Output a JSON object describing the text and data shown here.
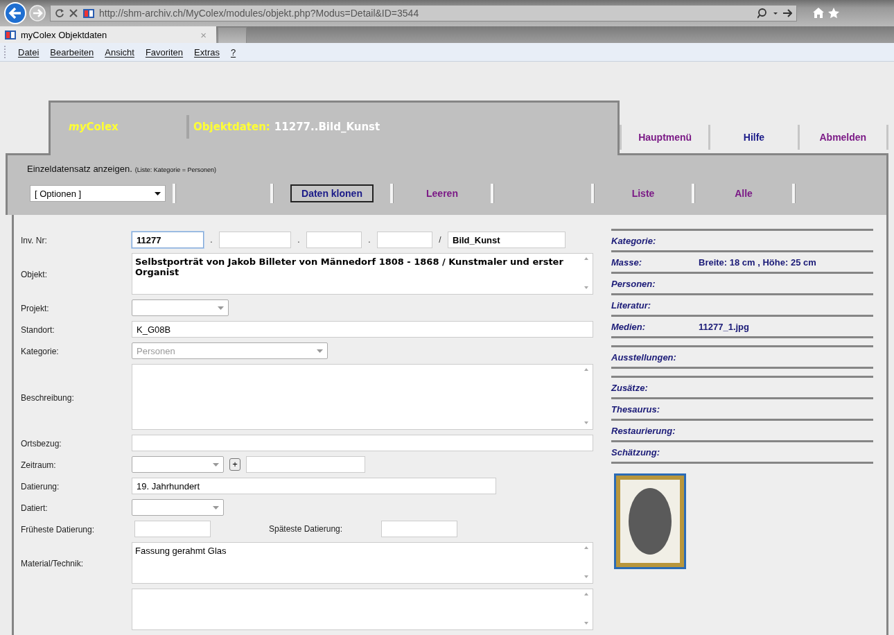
{
  "browser": {
    "url": "http://shm-archiv.ch/MyColex/modules/objekt.php?Modus=Detail&ID=3544",
    "tab_title": "myColex Objektdaten",
    "tab_close": "×",
    "menu": [
      {
        "label": "Datei"
      },
      {
        "label": "Bearbeiten"
      },
      {
        "label": "Ansicht"
      },
      {
        "label": "Favoriten"
      },
      {
        "label": "Extras"
      },
      {
        "label": "?"
      }
    ]
  },
  "app": {
    "brand_prefix": "my",
    "brand_name": "Colex",
    "title_label": "Objektdaten:",
    "title_value": "11277..Bild_Kunst",
    "nav": [
      {
        "label": "Hauptmenü",
        "visited": true
      },
      {
        "label": "Hilfe",
        "visited": false
      },
      {
        "label": "Abmelden",
        "visited": true
      }
    ],
    "mode_text": "Einzeldatensatz anzeigen.",
    "filter_note": "(Liste: Kategorie = Personen)",
    "options_select": "[ Optionen ]",
    "actions": [
      {
        "kind": "gap"
      },
      {
        "kind": "button",
        "label": "Daten klonen"
      },
      {
        "kind": "link",
        "label": "Leeren"
      },
      {
        "kind": "gap"
      },
      {
        "kind": "link",
        "label": "Liste"
      },
      {
        "kind": "link",
        "label": "Alle"
      }
    ]
  },
  "form": {
    "rows": [
      {
        "kind": "inv",
        "label": "Inv. Nr:",
        "fields": [
          {
            "value": "11277",
            "focused": true
          },
          {
            "focused": false
          },
          {
            "focused": false
          },
          {
            "focused": false
          },
          {
            "value": "Bild_Kunst",
            "focused": false
          }
        ],
        "separators": [
          ".",
          ".",
          ".",
          "/"
        ]
      },
      {
        "kind": "textarea",
        "label": "Objekt:",
        "value": "Selbstporträt von Jakob Billeter von Männedorf 1808 - 1868 / Kunstmaler und erster Organist",
        "bold": true,
        "tall": false
      },
      {
        "kind": "select",
        "label": "Projekt:"
      },
      {
        "kind": "text",
        "label": "Standort:",
        "value": "K_G08B"
      },
      {
        "kind": "select",
        "label": "Kategorie:",
        "value": "Personen",
        "disabled": true
      },
      {
        "kind": "textarea",
        "label": "Beschreibung:",
        "bold": false,
        "tall": true
      },
      {
        "kind": "text",
        "label": "Ortsbezug:"
      },
      {
        "kind": "range",
        "label": "Zeitraum:",
        "plus": "+"
      },
      {
        "kind": "text",
        "label": "Datierung:",
        "value": "19. Jahrhundert"
      },
      {
        "kind": "select",
        "label": "Datiert:"
      },
      {
        "kind": "pair",
        "label": "Früheste Datierung:",
        "second_label": "Späteste Datierung:"
      },
      {
        "kind": "textarea",
        "label": "Material/Technik:",
        "value": "Fassung gerahmt Glas",
        "bold": false,
        "tall": false
      },
      {
        "kind": "textarea",
        "tall": false
      }
    ]
  },
  "side": {
    "items": [
      {
        "label": "Kategorie:"
      },
      {
        "label": "Masse:",
        "value": "Breite: 18 cm , Höhe: 25 cm"
      },
      {
        "label": "Personen:"
      },
      {
        "label": "Literatur:"
      },
      {
        "label": "Medien:",
        "value": "11277_1.jpg",
        "group_end": true
      },
      {
        "label": "Ausstellungen:",
        "group_end": true
      },
      {
        "label": "Zusätze:"
      },
      {
        "label": "Thesaurus:"
      },
      {
        "label": "Restaurierung:"
      },
      {
        "label": "Schätzung:"
      }
    ]
  }
}
